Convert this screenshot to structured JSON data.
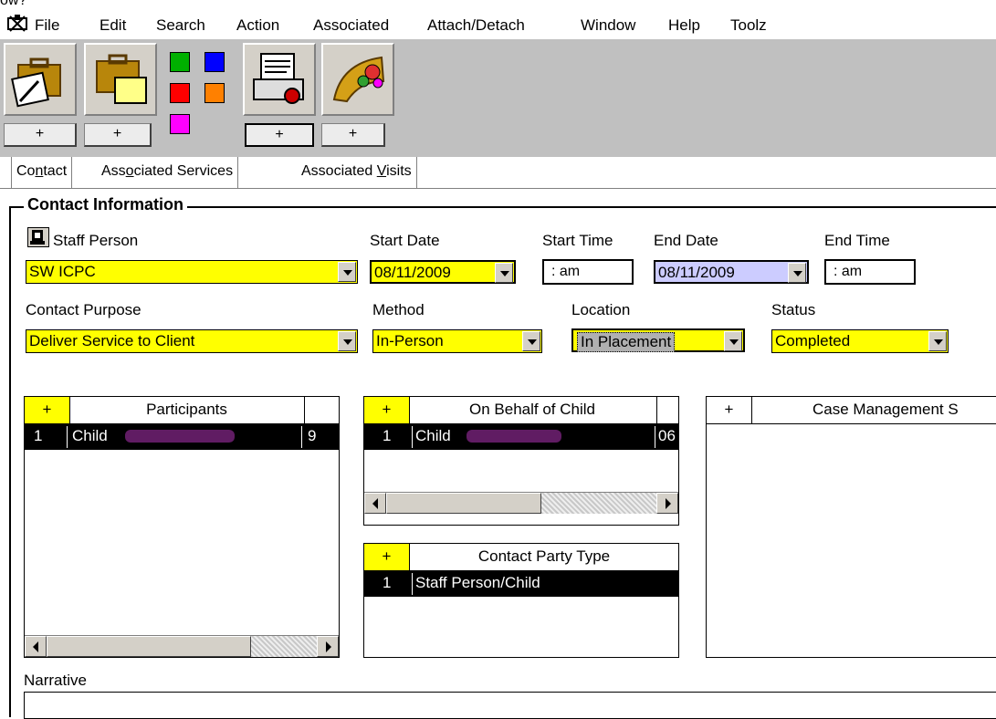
{
  "window_caption_fragment": "ow?",
  "menu": [
    "File",
    "Edit",
    "Search",
    "Action",
    "Associated",
    "Attach/Detach",
    "Window",
    "Help",
    "Toolz"
  ],
  "toolbar": {
    "plus_label": "+",
    "swatch_colors": [
      "#00b000",
      "#0000ff",
      "#ff0000",
      "#ff8000",
      "#ff00ff"
    ]
  },
  "tabs": [
    {
      "pre": "Co",
      "ul": "n",
      "post": "tact"
    },
    {
      "pre": "Ass",
      "ul": "o",
      "post": "ciated Services"
    },
    {
      "pre": "Associated ",
      "ul": "V",
      "post": "isits"
    }
  ],
  "group_title": "Contact Information",
  "fields": {
    "staff_person": {
      "label": "Staff Person",
      "value": "SW ICPC"
    },
    "start_date": {
      "label": "Start Date",
      "value": "08/11/2009"
    },
    "start_time": {
      "label": "Start Time",
      "value": ":  am"
    },
    "end_date": {
      "label": "End Date",
      "value": "08/11/2009"
    },
    "end_time": {
      "label": "End Time",
      "value": ":  am"
    },
    "contact_purpose": {
      "label": "Contact Purpose",
      "value": "Deliver Service to Client"
    },
    "method": {
      "label": "Method",
      "value": "In-Person"
    },
    "location": {
      "label": "Location",
      "value": "In Placement"
    },
    "status": {
      "label": "Status",
      "value": "Completed"
    }
  },
  "panels": {
    "participants": {
      "add": "+",
      "title": "Participants",
      "row": {
        "num": "1",
        "name": "Child",
        "extra": "9"
      }
    },
    "on_behalf": {
      "add": "+",
      "title": "On Behalf of Child",
      "row": {
        "num": "1",
        "name": "Child",
        "extra": "06"
      }
    },
    "contact_party": {
      "add": "+",
      "title": "Contact Party Type",
      "row": {
        "num": "1",
        "name": "Staff Person/Child"
      }
    },
    "case_mgmt": {
      "add": "+",
      "title": "Case Management S"
    }
  },
  "narrative_label": "Narrative"
}
